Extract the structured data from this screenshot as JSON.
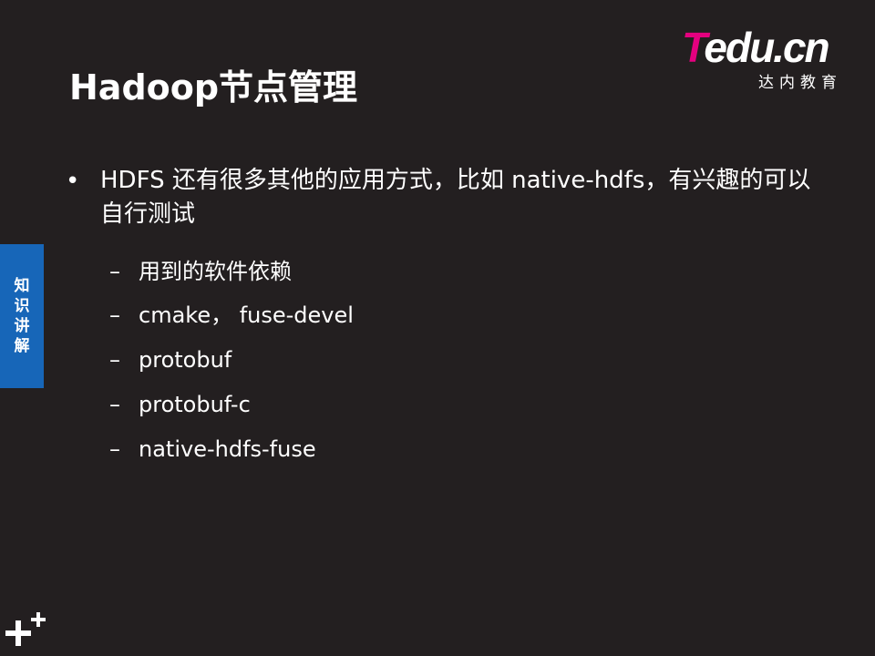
{
  "logo": {
    "t": "T",
    "rest": "edu.cn",
    "subtitle": "达内教育"
  },
  "title": "Hadoop节点管理",
  "side_tab": "知识讲解",
  "bullet": {
    "mark": "•",
    "text": "HDFS  还有很多其他的应用方式，比如  native-hdfs，有兴趣的可以自行测试"
  },
  "sub_dash": "–",
  "sub_items": [
    "用到的软件依赖",
    "cmake， fuse-devel",
    "protobuf",
    "protobuf-c",
    "native-hdfs-fuse"
  ],
  "colors": {
    "background": "#231f20",
    "accent": "#e4007f",
    "side_tab": "#1766b8"
  }
}
